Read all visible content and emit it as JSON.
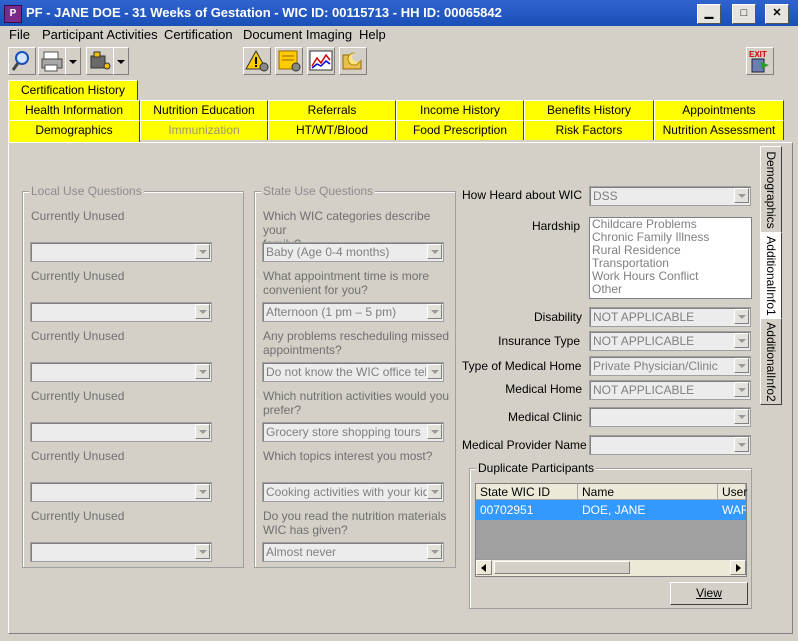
{
  "window": {
    "title": "PF - JANE DOE - 31 Weeks of Gestation - WIC ID: 00115713 - HH ID: 00065842"
  },
  "menu": [
    "File",
    "Participant Activities",
    "Certification",
    "Document Imaging",
    "Help"
  ],
  "toolbar": {
    "exit_label": "EXIT"
  },
  "tabs": {
    "top": "Certification History",
    "row1": [
      "Health Information",
      "Nutrition Education",
      "Referrals",
      "Income History",
      "Benefits History",
      "Appointments"
    ],
    "row2": [
      "Demographics",
      "Immunization",
      "HT/WT/Blood",
      "Food Prescription",
      "Risk Factors",
      "Nutrition Assessment"
    ]
  },
  "local": {
    "legend": "Local Use Questions",
    "questions": [
      "Currently Unused",
      "Currently Unused",
      "Currently Unused",
      "Currently Unused",
      "Currently Unused",
      "Currently Unused"
    ]
  },
  "state": {
    "legend": "State Use Questions",
    "items": [
      {
        "q1": "Which WIC categories describe your",
        "q2": "family?",
        "a": "Baby (Age 0-4 months)"
      },
      {
        "q1": "What appointment time is more",
        "q2": "convenient for you?",
        "a": "Afternoon (1 pm – 5 pm)"
      },
      {
        "q1": "Any problems rescheduling missed",
        "q2": "appointments?",
        "a": "Do not know the WIC office teleph"
      },
      {
        "q1": "Which nutrition activities would you",
        "q2": "prefer?",
        "a": "Grocery store shopping tours"
      },
      {
        "q1": "Which topics interest you most?",
        "q2": "",
        "a": "Cooking activities with your kids"
      },
      {
        "q1": "Do you read the nutrition materials",
        "q2": "WIC has given?",
        "a": "Almost never"
      }
    ]
  },
  "right": {
    "how_heard": {
      "label": "How Heard about WIC",
      "value": "DSS"
    },
    "hardship": {
      "label": "Hardship",
      "options": [
        "Childcare Problems",
        "Chronic Family Illness",
        "Rural Residence",
        "Transportation",
        "Work Hours Conflict",
        "Other"
      ]
    },
    "disability": {
      "label": "Disability",
      "value": "NOT APPLICABLE"
    },
    "insurance": {
      "label": "Insurance Type",
      "value": "NOT APPLICABLE"
    },
    "med_home_type": {
      "label": "Type of Medical Home",
      "value": "Private Physician/Clinic"
    },
    "med_home": {
      "label": "Medical Home",
      "value": "NOT APPLICABLE"
    },
    "med_clinic": {
      "label": "Medical Clinic",
      "value": ""
    },
    "med_provider": {
      "label": "Medical Provider Name",
      "value": ""
    }
  },
  "duplicates": {
    "legend": "Duplicate Participants",
    "columns": [
      "State WIC ID",
      "Name",
      "User"
    ],
    "row": [
      "00702951",
      "DOE, JANE",
      "WAR"
    ],
    "view_label": "View"
  },
  "side_tabs": [
    "Demographics",
    "AdditionalInfo1",
    "AdditionalInfo2"
  ]
}
